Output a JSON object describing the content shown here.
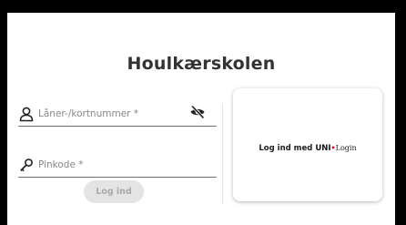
{
  "title": "Houlkærskolen",
  "username_field": {
    "placeholder": "Låner-/kortnummer *",
    "value": ""
  },
  "pin_field": {
    "placeholder": "Pinkode *",
    "value": ""
  },
  "login_button_label": "Log ind",
  "uni_login": {
    "prefix": "Log ind med ",
    "brand_uni": "UNI",
    "brand_dot": "•",
    "brand_login": "Login",
    "brand_dot_color": "#d9002b"
  },
  "icons": {
    "user": "user-icon",
    "toggle_visibility": "eye-off-icon",
    "pin": "key-icon"
  }
}
